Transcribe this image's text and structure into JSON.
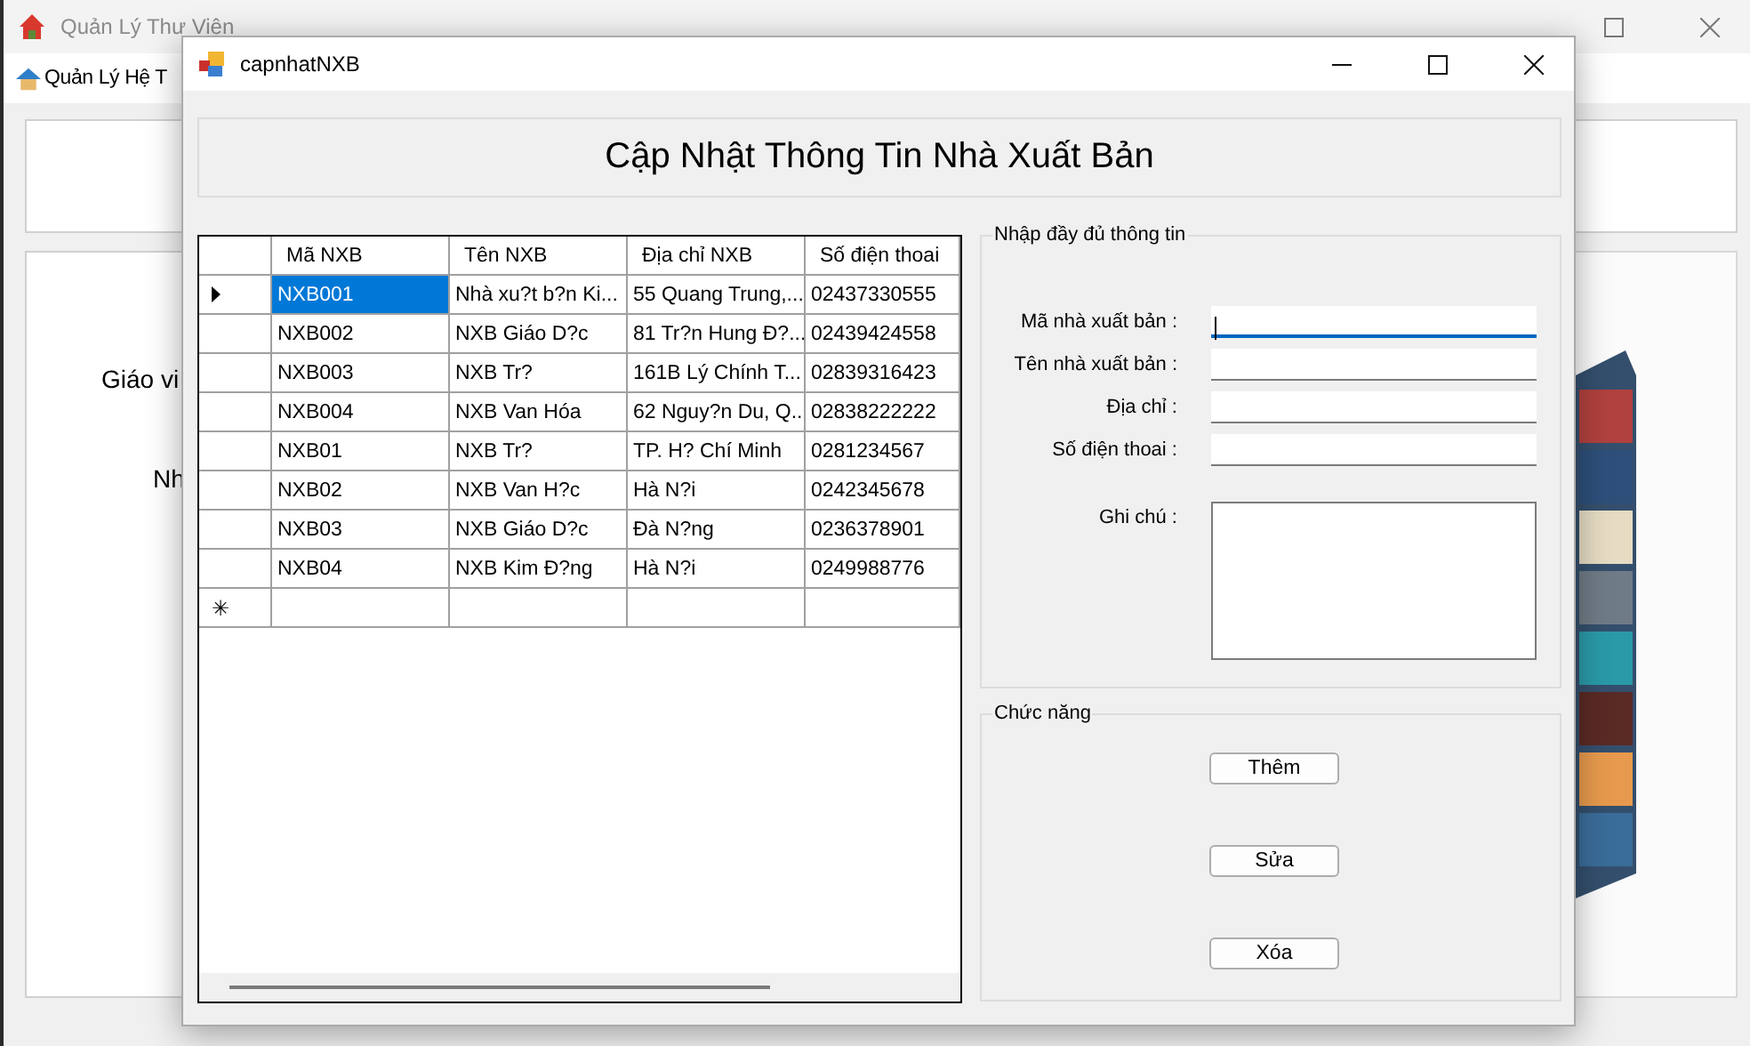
{
  "main_window": {
    "title": "Quản Lý Thư Viện",
    "menu_items": [
      "Quản Lý Hệ T"
    ],
    "labels": [
      "Giáo vi",
      "Nh"
    ],
    "picture": {
      "kind": "picture"
    }
  },
  "dialog": {
    "title": "capnhatNXB",
    "heading": "Cập Nhật Thông Tin Nhà Xuất Bản",
    "table": {
      "columns": [
        "Mã NXB",
        "Tên NXB",
        "Địa chỉ NXB",
        "Số điện thoai"
      ],
      "new_row_marker": "✳",
      "rows": [
        {
          "selected": true,
          "cells": [
            "NXB001",
            "Nhà xu?t b?n Ki...",
            "55 Quang Trung,...",
            "02437330555"
          ]
        },
        {
          "selected": false,
          "cells": [
            "NXB002",
            "NXB Giáo D?c",
            "81 Tr?n Hung Đ?...",
            "02439424558"
          ]
        },
        {
          "selected": false,
          "cells": [
            "NXB003",
            "NXB Tr?",
            "161B Lý Chính T...",
            "02839316423"
          ]
        },
        {
          "selected": false,
          "cells": [
            "NXB004",
            "NXB Van Hóa",
            "62 Nguy?n Du, Q...",
            "02838222222"
          ]
        },
        {
          "selected": false,
          "cells": [
            "NXB01",
            "NXB Tr?",
            "TP. H? Chí Minh",
            "0281234567"
          ]
        },
        {
          "selected": false,
          "cells": [
            "NXB02",
            "NXB Van H?c",
            "Hà N?i",
            "0242345678"
          ]
        },
        {
          "selected": false,
          "cells": [
            "NXB03",
            "NXB Giáo D?c",
            "Đà N?ng",
            "0236378901"
          ]
        },
        {
          "selected": false,
          "cells": [
            "NXB04",
            "NXB Kim Đ?ng",
            "Hà N?i",
            "0249988776"
          ]
        }
      ]
    },
    "info_group": {
      "title": "Nhập đầy đủ thông tin",
      "fields": [
        {
          "label": "Mã nhà xuất bản :",
          "kind": "line",
          "focused": true
        },
        {
          "label": "Tên nhà xuất bản :",
          "kind": "line",
          "focused": false
        },
        {
          "label": "Địa chỉ :",
          "kind": "line",
          "focused": false
        },
        {
          "label": "Số điện thoai :",
          "kind": "line",
          "focused": false
        },
        {
          "label": "Ghi chú :",
          "kind": "multiline",
          "focused": false
        }
      ]
    },
    "actions_group": {
      "title": "Chức năng",
      "buttons": [
        "Thêm",
        "Sửa",
        "Xóa"
      ]
    }
  }
}
